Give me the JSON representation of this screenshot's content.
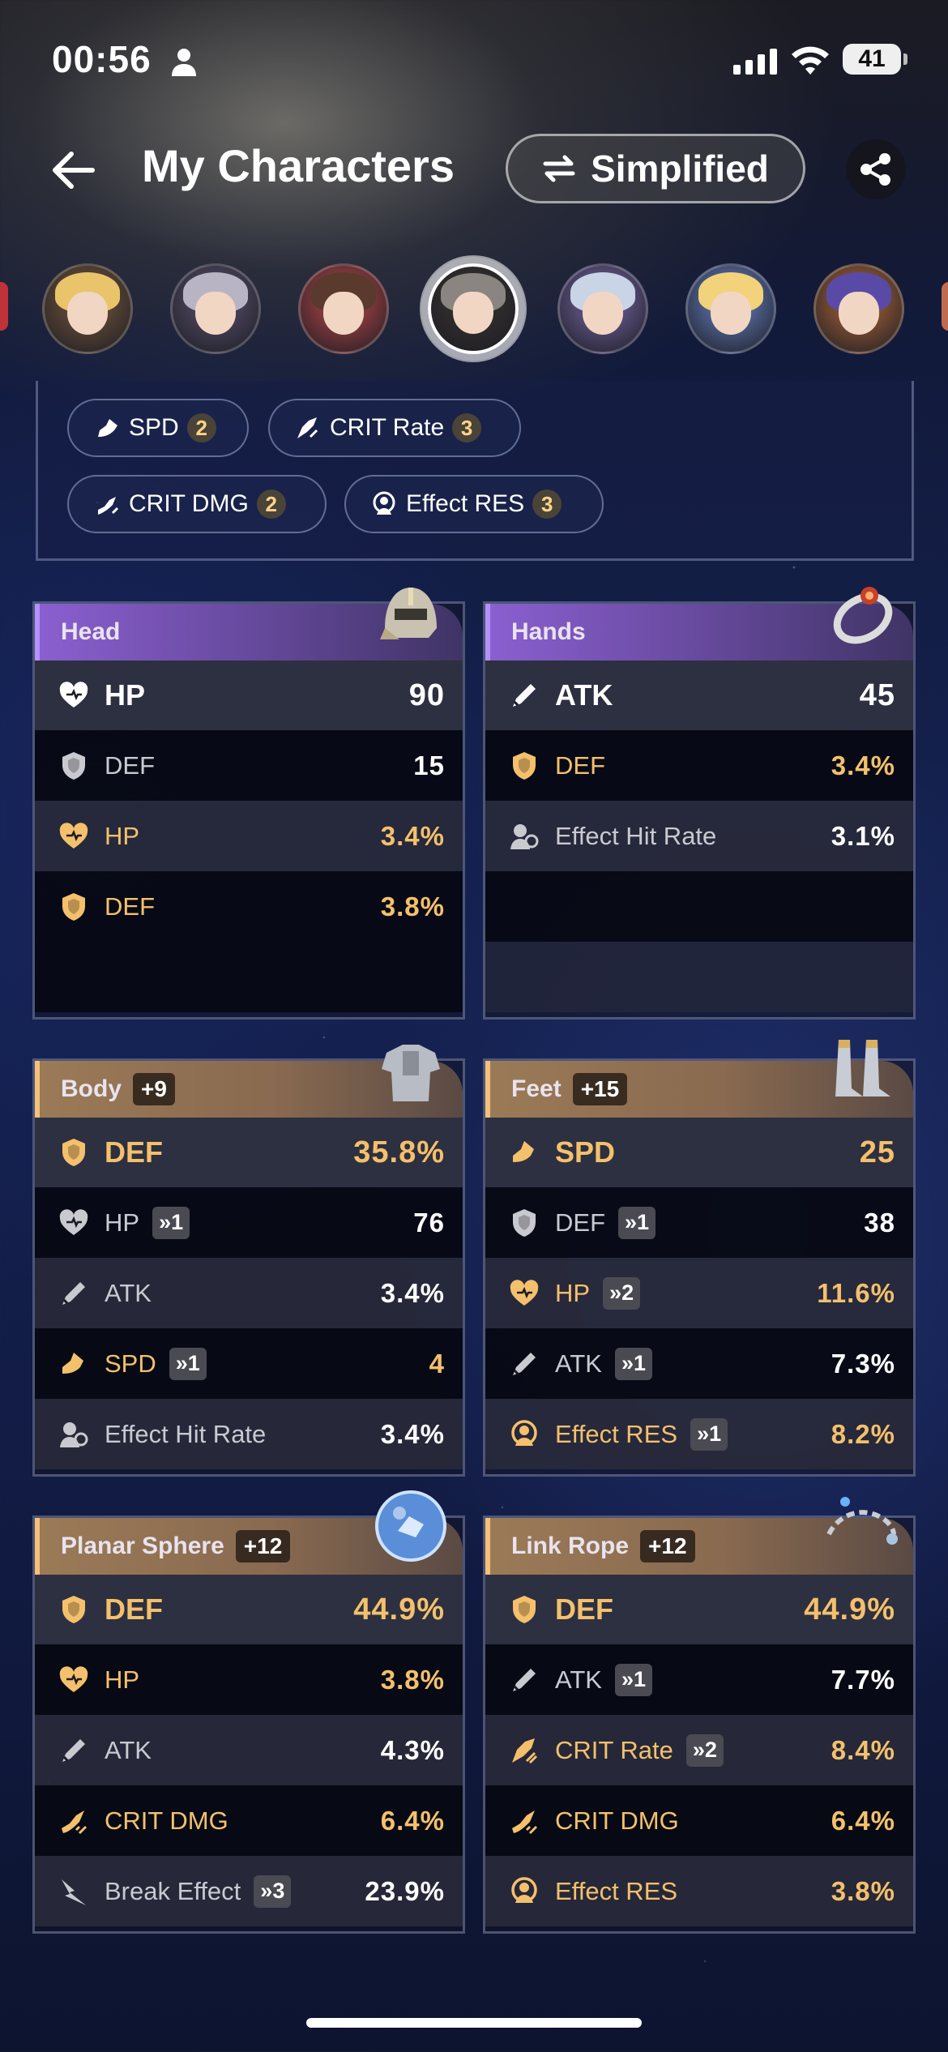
{
  "status": {
    "time": "00:56",
    "battery": "41"
  },
  "header": {
    "title": "My Characters",
    "mode_button": "Simplified"
  },
  "avatars": [
    {
      "name": "character-1",
      "hair": "#e9c46a",
      "bg": "#7a5a3c"
    },
    {
      "name": "character-2",
      "hair": "#b9b4c4",
      "bg": "#5c5470"
    },
    {
      "name": "character-3",
      "hair": "#5a3a2c",
      "bg": "#c04a4a"
    },
    {
      "name": "character-4",
      "hair": "#8a8580",
      "bg": "#3a3530",
      "selected": true
    },
    {
      "name": "character-5",
      "hair": "#c9d4e6",
      "bg": "#7a6aa8"
    },
    {
      "name": "character-6",
      "hair": "#f2d27a",
      "bg": "#6a86c8"
    },
    {
      "name": "character-7",
      "hair": "#5a4aa8",
      "bg": "#b46a3a"
    }
  ],
  "set_tags": [
    {
      "label": "SPD",
      "count": "2",
      "icon": "spd-icon"
    },
    {
      "label": "CRIT Rate",
      "count": "3",
      "icon": "crit-rate-icon"
    },
    {
      "label": "CRIT DMG",
      "count": "2",
      "icon": "crit-dmg-icon"
    },
    {
      "label": "Effect RES",
      "count": "3",
      "icon": "effect-res-icon"
    }
  ],
  "relics": {
    "head": {
      "title": "Head",
      "level": "",
      "main": {
        "name": "HP",
        "value": "90",
        "icon": "hp-icon"
      },
      "subs": [
        {
          "name": "DEF",
          "value": "15",
          "roll": "",
          "highlight": false,
          "icon": "def-icon"
        },
        {
          "name": "HP",
          "value": "3.4%",
          "roll": "",
          "highlight": true,
          "icon": "hp-icon"
        },
        {
          "name": "DEF",
          "value": "3.8%",
          "roll": "",
          "highlight": true,
          "icon": "def-icon"
        }
      ]
    },
    "hands": {
      "title": "Hands",
      "level": "",
      "main": {
        "name": "ATK",
        "value": "45",
        "icon": "atk-icon"
      },
      "subs": [
        {
          "name": "DEF",
          "value": "3.4%",
          "roll": "",
          "highlight": true,
          "icon": "def-icon"
        },
        {
          "name": "Effect Hit Rate",
          "value": "3.1%",
          "roll": "",
          "highlight": false,
          "icon": "effect-hit-rate-icon"
        }
      ]
    },
    "body": {
      "title": "Body",
      "level": "+9",
      "main": {
        "name": "DEF",
        "value": "35.8%",
        "icon": "def-icon"
      },
      "subs": [
        {
          "name": "HP",
          "value": "76",
          "roll": "»1",
          "highlight": false,
          "icon": "hp-icon"
        },
        {
          "name": "ATK",
          "value": "3.4%",
          "roll": "",
          "highlight": false,
          "icon": "atk-icon"
        },
        {
          "name": "SPD",
          "value": "4",
          "roll": "»1",
          "highlight": true,
          "icon": "spd-icon"
        },
        {
          "name": "Effect Hit Rate",
          "value": "3.4%",
          "roll": "",
          "highlight": false,
          "icon": "effect-hit-rate-icon"
        }
      ]
    },
    "feet": {
      "title": "Feet",
      "level": "+15",
      "main": {
        "name": "SPD",
        "value": "25",
        "icon": "spd-icon"
      },
      "subs": [
        {
          "name": "DEF",
          "value": "38",
          "roll": "»1",
          "highlight": false,
          "icon": "def-icon"
        },
        {
          "name": "HP",
          "value": "11.6%",
          "roll": "»2",
          "highlight": true,
          "icon": "hp-icon"
        },
        {
          "name": "ATK",
          "value": "7.3%",
          "roll": "»1",
          "highlight": false,
          "icon": "atk-icon"
        },
        {
          "name": "Effect RES",
          "value": "8.2%",
          "roll": "»1",
          "highlight": true,
          "icon": "effect-res-icon"
        }
      ]
    },
    "sphere": {
      "title": "Planar Sphere",
      "level": "+12",
      "main": {
        "name": "DEF",
        "value": "44.9%",
        "icon": "def-icon"
      },
      "subs": [
        {
          "name": "HP",
          "value": "3.8%",
          "roll": "",
          "highlight": true,
          "icon": "hp-icon"
        },
        {
          "name": "ATK",
          "value": "4.3%",
          "roll": "",
          "highlight": false,
          "icon": "atk-icon"
        },
        {
          "name": "CRIT DMG",
          "value": "6.4%",
          "roll": "",
          "highlight": true,
          "icon": "crit-dmg-icon"
        },
        {
          "name": "Break Effect",
          "value": "23.9%",
          "roll": "»3",
          "highlight": false,
          "icon": "break-effect-icon"
        }
      ]
    },
    "rope": {
      "title": "Link Rope",
      "level": "+12",
      "main": {
        "name": "DEF",
        "value": "44.9%",
        "icon": "def-icon"
      },
      "subs": [
        {
          "name": "ATK",
          "value": "7.7%",
          "roll": "»1",
          "highlight": false,
          "icon": "atk-icon"
        },
        {
          "name": "CRIT Rate",
          "value": "8.4%",
          "roll": "»2",
          "highlight": true,
          "icon": "crit-rate-icon"
        },
        {
          "name": "CRIT DMG",
          "value": "6.4%",
          "roll": "",
          "highlight": true,
          "icon": "crit-dmg-icon"
        },
        {
          "name": "Effect RES",
          "value": "3.8%",
          "roll": "",
          "highlight": true,
          "icon": "effect-res-icon"
        }
      ]
    }
  }
}
